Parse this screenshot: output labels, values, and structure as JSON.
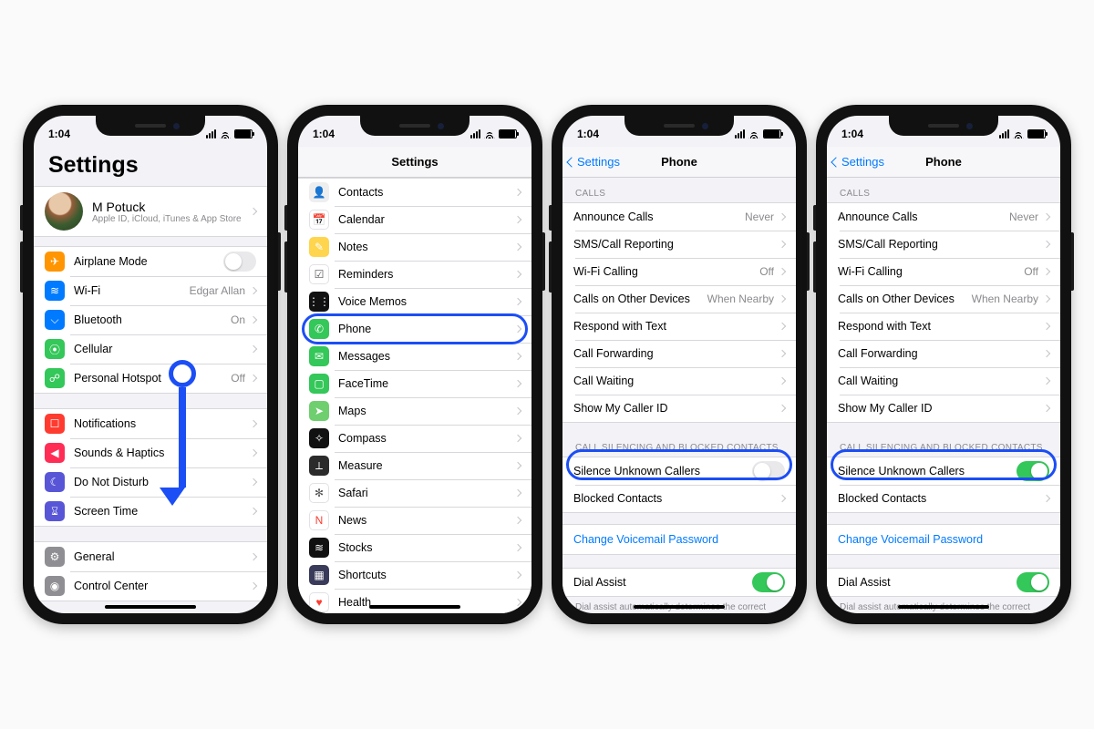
{
  "status_time": "1:04",
  "p1": {
    "title": "Settings",
    "profile_name": "M Potuck",
    "profile_sub": "Apple ID, iCloud, iTunes & App Store",
    "g1": [
      {
        "label": "Airplane Mode",
        "bg": "#ff9500",
        "glyph": "✈︎",
        "toggle": false
      },
      {
        "label": "Wi-Fi",
        "bg": "#007aff",
        "glyph": "≋",
        "value": "Edgar Allan"
      },
      {
        "label": "Bluetooth",
        "bg": "#007aff",
        "glyph": "⌵",
        "value": "On"
      },
      {
        "label": "Cellular",
        "bg": "#34c759",
        "glyph": "⦿",
        "value": ""
      },
      {
        "label": "Personal Hotspot",
        "bg": "#34c759",
        "glyph": "☍",
        "value": "Off"
      }
    ],
    "g2": [
      {
        "label": "Notifications",
        "bg": "#ff3b30",
        "glyph": "☐"
      },
      {
        "label": "Sounds & Haptics",
        "bg": "#ff2d55",
        "glyph": "◀︎"
      },
      {
        "label": "Do Not Disturb",
        "bg": "#5856d6",
        "glyph": "☾"
      },
      {
        "label": "Screen Time",
        "bg": "#5856d6",
        "glyph": "⌛︎"
      }
    ],
    "g3": [
      {
        "label": "General",
        "bg": "#8e8e93",
        "glyph": "⚙︎"
      },
      {
        "label": "Control Center",
        "bg": "#8e8e93",
        "glyph": "◉"
      }
    ]
  },
  "p2": {
    "title": "Settings",
    "items": [
      {
        "label": "Contacts",
        "bg": "#eeeeee",
        "glyph": "👤",
        "dark": true
      },
      {
        "label": "Calendar",
        "bg": "#ffffff",
        "glyph": "📅",
        "dark": true
      },
      {
        "label": "Notes",
        "bg": "#ffd54d",
        "glyph": "✎"
      },
      {
        "label": "Reminders",
        "bg": "#ffffff",
        "glyph": "☑︎",
        "dark": true
      },
      {
        "label": "Voice Memos",
        "bg": "#111",
        "glyph": "⋮⋮"
      },
      {
        "label": "Phone",
        "bg": "#34c759",
        "glyph": "✆",
        "hl": true
      },
      {
        "label": "Messages",
        "bg": "#34c759",
        "glyph": "✉︎"
      },
      {
        "label": "FaceTime",
        "bg": "#34c759",
        "glyph": "▢"
      },
      {
        "label": "Maps",
        "bg": "#6fcf6f",
        "glyph": "➤"
      },
      {
        "label": "Compass",
        "bg": "#111",
        "glyph": "✧"
      },
      {
        "label": "Measure",
        "bg": "#2b2b2b",
        "glyph": "⟂"
      },
      {
        "label": "Safari",
        "bg": "#fff",
        "glyph": "✻",
        "dark": true
      },
      {
        "label": "News",
        "bg": "#fff",
        "glyph": "N",
        "dark": true,
        "red": true
      },
      {
        "label": "Stocks",
        "bg": "#111",
        "glyph": "≋"
      },
      {
        "label": "Shortcuts",
        "bg": "#3a3a5a",
        "glyph": "▦"
      },
      {
        "label": "Health",
        "bg": "#fff",
        "glyph": "♥︎",
        "dark": true,
        "red": true
      }
    ]
  },
  "p3": {
    "back": "Settings",
    "title": "Phone",
    "s1": "CALLS",
    "r1": [
      {
        "label": "Announce Calls",
        "value": "Never"
      },
      {
        "label": "SMS/Call Reporting"
      },
      {
        "label": "Wi-Fi Calling",
        "value": "Off"
      },
      {
        "label": "Calls on Other Devices",
        "value": "When Nearby"
      },
      {
        "label": "Respond with Text"
      },
      {
        "label": "Call Forwarding"
      },
      {
        "label": "Call Waiting"
      },
      {
        "label": "Show My Caller ID"
      }
    ],
    "s2": "CALL SILENCING AND BLOCKED CONTACTS",
    "r2": [
      {
        "label": "Silence Unknown Callers",
        "toggle": true,
        "on_a": false,
        "on_b": true,
        "hl": true
      },
      {
        "label": "Blocked Contacts"
      }
    ],
    "link": "Change Voicemail Password",
    "r3_label": "Dial Assist",
    "r3_on": true,
    "footer": "Dial assist automatically determines the correct"
  }
}
